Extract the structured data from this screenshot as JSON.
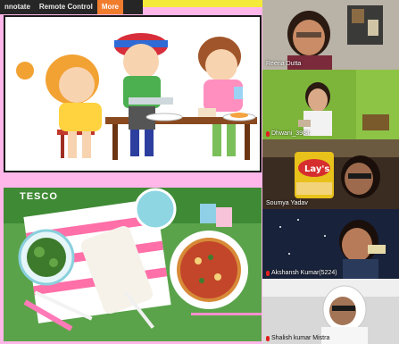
{
  "toolbar": {
    "items": [
      {
        "label": "nnotate"
      },
      {
        "label": "Remote Control"
      },
      {
        "label": "More"
      }
    ]
  },
  "slides": {
    "slide2": {
      "brand": "TESCO"
    }
  },
  "participants": [
    {
      "name": "Reena Dutta",
      "muted": false
    },
    {
      "name": "Dhwani_3984",
      "muted": true
    },
    {
      "name": "Soumya Yadav",
      "muted": false
    },
    {
      "name": "Akshansh Kumar(5224)",
      "muted": true
    },
    {
      "name": "Shalish kumar Mistra",
      "muted": true
    }
  ],
  "colors": {
    "toolbar_bg": "#262626",
    "active_tab": "#f07c2e",
    "page_bg": "#ffb6e9",
    "mic_muted": "#e02020"
  }
}
